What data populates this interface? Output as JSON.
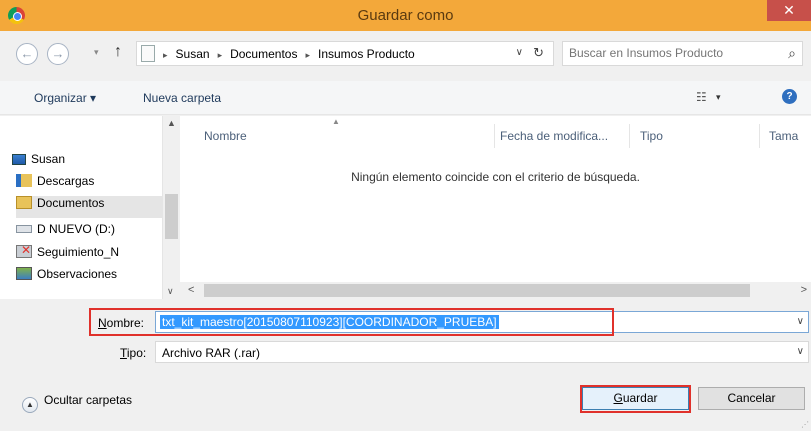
{
  "window": {
    "title": "Guardar como",
    "close": "✕",
    "colors": {
      "titlebar": "#f3a83a",
      "close": "#c7504a",
      "highlight": "#e0312b",
      "selection": "#3399ff"
    }
  },
  "nav": {
    "back": "←",
    "forward": "→",
    "recent": "▾",
    "up": "↑"
  },
  "address": {
    "crumbs": [
      "Susan",
      "Documentos",
      "Insumos Producto"
    ],
    "sep": "▸",
    "dropdown": "∨",
    "refresh": "↻"
  },
  "search": {
    "placeholder": "Buscar en Insumos Producto",
    "icon": "⌕"
  },
  "toolbar": {
    "organize": "Organizar ▾",
    "new_folder": "Nueva carpeta",
    "views": "☷",
    "views_drop": "▾",
    "help": "?"
  },
  "sidebar": {
    "items": [
      {
        "label": "Susan",
        "icon": "user-computer-icon"
      },
      {
        "label": "Descargas",
        "icon": "downloads-folder-icon"
      },
      {
        "label": "Documentos",
        "icon": "documents-folder-icon",
        "selected": true
      },
      {
        "label": "D NUEVO (D:)",
        "icon": "drive-icon"
      },
      {
        "label": "Seguimiento_N",
        "icon": "network-drive-icon"
      },
      {
        "label": "Observaciones",
        "icon": "network-drive-icon"
      }
    ],
    "scroll_up": "▲",
    "scroll_down": "∨"
  },
  "files": {
    "columns": [
      "Nombre",
      "Fecha de modifica...",
      "Tipo",
      "Tama"
    ],
    "sort_arrow": "▲",
    "empty_message": "Ningún elemento coincide con el criterio de búsqueda.",
    "scroll_left": "<",
    "scroll_right": ">"
  },
  "form": {
    "name_label_u": "N",
    "name_label_rest": "ombre:",
    "name_value": "txt_kit_maestro[20150807110923][COORDINADOR_PRUEBA]",
    "type_label_u": "T",
    "type_label_rest": "ipo:",
    "type_value": "Archivo RAR (.rar)",
    "dropdown": "∨"
  },
  "footer": {
    "hide_folders": "Ocultar carpetas",
    "hide_chev": "▲",
    "save_u": "G",
    "save_rest": "uardar",
    "cancel": "Cancelar"
  }
}
